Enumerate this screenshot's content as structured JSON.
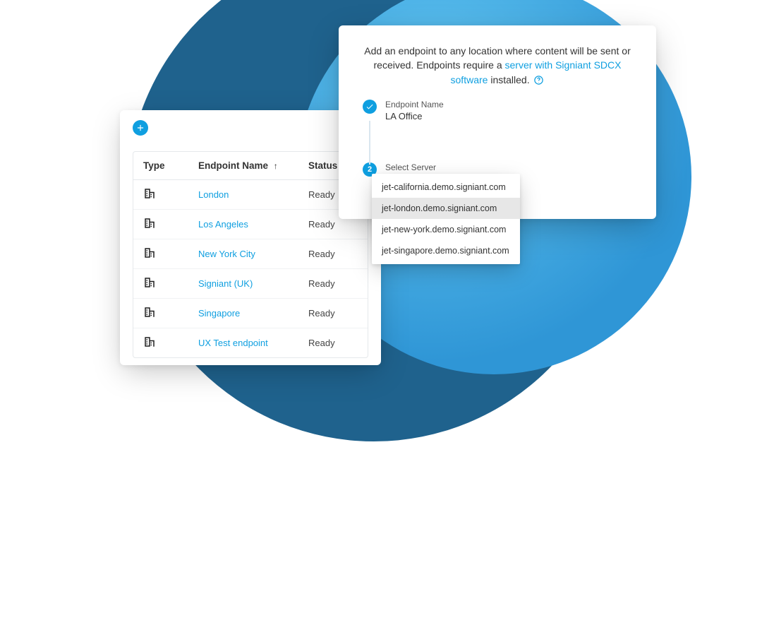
{
  "endpoints_table": {
    "headers": {
      "type": "Type",
      "name": "Endpoint Name",
      "status": "Status"
    },
    "sort_indicator": "↑",
    "rows": [
      {
        "name": "London",
        "status": "Ready"
      },
      {
        "name": "Los Angeles",
        "status": "Ready"
      },
      {
        "name": "New York City",
        "status": "Ready"
      },
      {
        "name": "Signiant (UK)",
        "status": "Ready"
      },
      {
        "name": "Singapore",
        "status": "Ready"
      },
      {
        "name": "UX Test endpoint",
        "status": "Ready"
      }
    ]
  },
  "add_panel": {
    "desc_pre": "Add an endpoint to any location where content will be sent or received. Endpoints require a ",
    "desc_link": "server with Signiant SDCX software",
    "desc_post": " installed. ",
    "step1_label": "Endpoint Name",
    "step1_value": "LA Office",
    "step2_num": "2",
    "step2_label": "Select Server"
  },
  "server_dropdown": {
    "items": [
      "jet-california.demo.signiant.com",
      "jet-london.demo.signiant.com",
      "jet-new-york.demo.signiant.com",
      "jet-singapore.demo.signiant.com"
    ],
    "selected_index": 1
  }
}
